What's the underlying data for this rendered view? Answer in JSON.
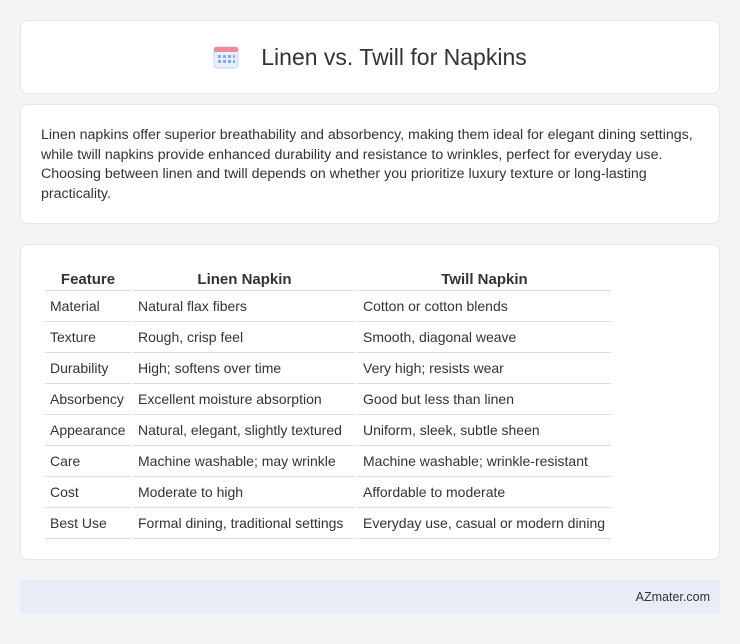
{
  "header": {
    "title": "Linen vs. Twill for Napkins",
    "icon": "calendar-icon"
  },
  "intro": {
    "text": "Linen napkins offer superior breathability and absorbency, making them ideal for elegant dining settings, while twill napkins provide enhanced durability and resistance to wrinkles, perfect for everyday use. Choosing between linen and twill depends on whether you prioritize luxury texture or long-lasting practicality."
  },
  "table": {
    "headers": [
      "Feature",
      "Linen Napkin",
      "Twill Napkin"
    ],
    "rows": [
      [
        "Material",
        "Natural flax fibers",
        "Cotton or cotton blends"
      ],
      [
        "Texture",
        "Rough, crisp feel",
        "Smooth, diagonal weave"
      ],
      [
        "Durability",
        "High; softens over time",
        "Very high; resists wear"
      ],
      [
        "Absorbency",
        "Excellent moisture absorption",
        "Good but less than linen"
      ],
      [
        "Appearance",
        "Natural, elegant, slightly textured",
        "Uniform, sleek, subtle sheen"
      ],
      [
        "Care",
        "Machine washable; may wrinkle",
        "Machine washable; wrinkle-resistant"
      ],
      [
        "Cost",
        "Moderate to high",
        "Affordable to moderate"
      ],
      [
        "Best Use",
        "Formal dining, traditional settings",
        "Everyday use, casual or modern dining"
      ]
    ]
  },
  "footer": {
    "brand": "AZmater.com"
  },
  "colors": {
    "background": "#f3f4f6",
    "card": "#ffffff",
    "footer_bg": "#e7ecf6",
    "icon_accent": "#6d8fe0"
  }
}
